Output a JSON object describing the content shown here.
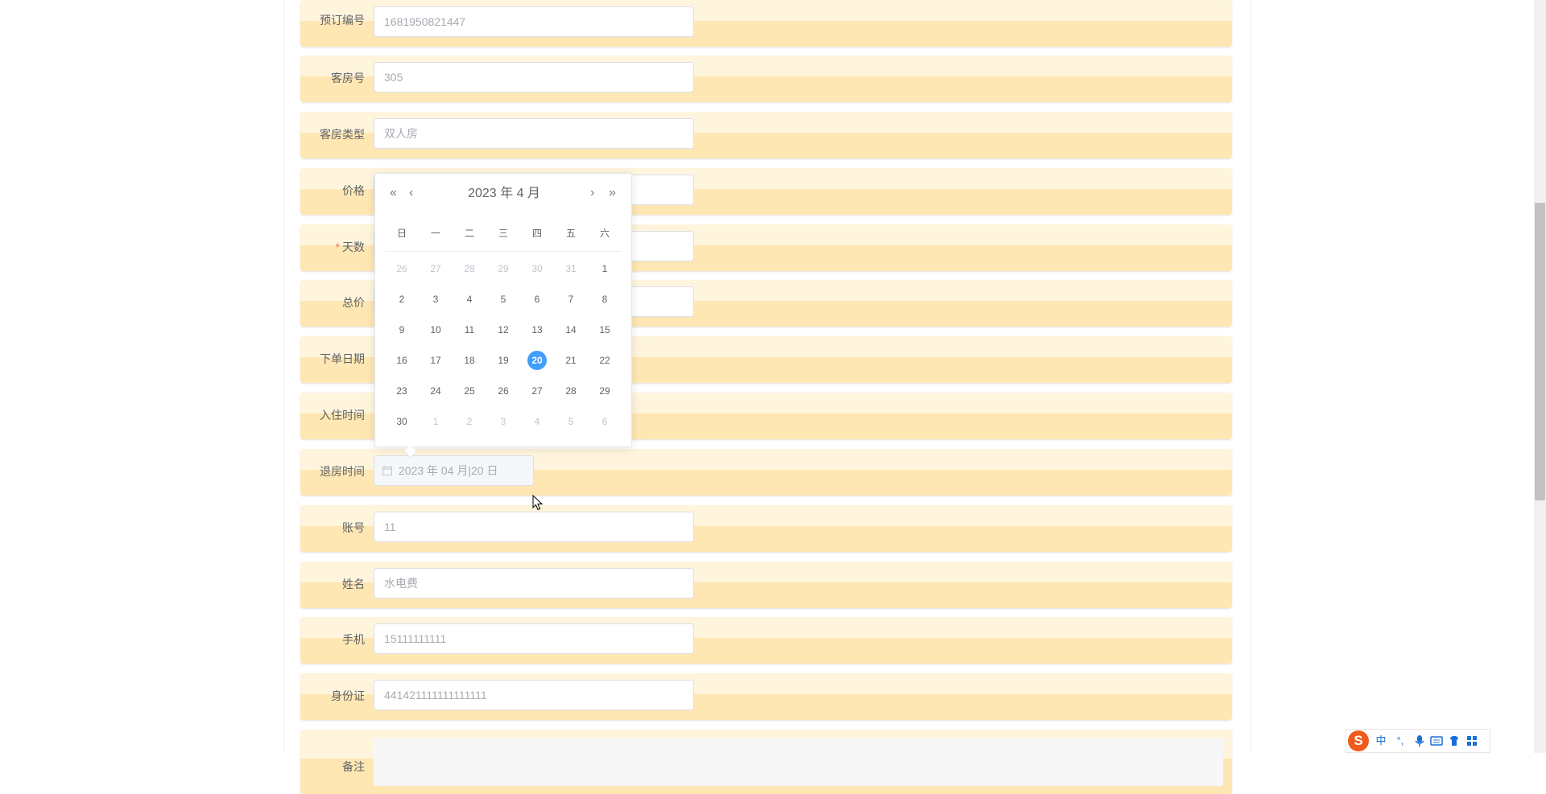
{
  "form": {
    "booking_no": {
      "label": "预订编号",
      "value": "1681950821447"
    },
    "room_no": {
      "label": "客房号",
      "value": "305"
    },
    "room_type": {
      "label": "客房类型",
      "value": "双人房"
    },
    "price": {
      "label": "价格"
    },
    "days": {
      "label": "天数",
      "required_mark": "*"
    },
    "total": {
      "label": "总价"
    },
    "order_date": {
      "label": "下单日期"
    },
    "checkin_time": {
      "label": "入住时间"
    },
    "checkout_time": {
      "label": "退房时间",
      "value": "2023 年 04 月|20 日"
    },
    "account": {
      "label": "账号",
      "value": "11"
    },
    "name": {
      "label": "姓名",
      "value": "水电费"
    },
    "phone": {
      "label": "手机",
      "value": "15111111111"
    },
    "id_card": {
      "label": "身份证",
      "value": "441421111111111111"
    },
    "remark": {
      "label": "备注"
    }
  },
  "datepicker": {
    "title": "2023 年  4 月",
    "nav": {
      "prev_year": "«",
      "prev_month": "‹",
      "next_month": "›",
      "next_year": "»"
    },
    "weekdays": [
      "日",
      "一",
      "二",
      "三",
      "四",
      "五",
      "六"
    ],
    "weeks": [
      [
        "26",
        "27",
        "28",
        "29",
        "30",
        "31",
        "1"
      ],
      [
        "2",
        "3",
        "4",
        "5",
        "6",
        "7",
        "8"
      ],
      [
        "9",
        "10",
        "11",
        "12",
        "13",
        "14",
        "15"
      ],
      [
        "16",
        "17",
        "18",
        "19",
        "20",
        "21",
        "22"
      ],
      [
        "23",
        "24",
        "25",
        "26",
        "27",
        "28",
        "29"
      ],
      [
        "30",
        "1",
        "2",
        "3",
        "4",
        "5",
        "6"
      ]
    ],
    "selected_day": "20",
    "accent_color": "#409eff"
  },
  "ime": {
    "logo": "S",
    "mode": "中",
    "punct": "°,"
  }
}
